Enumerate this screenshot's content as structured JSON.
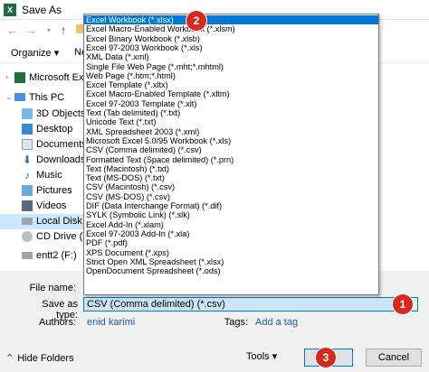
{
  "window": {
    "title": "Save As",
    "app_icon_letter": "X"
  },
  "commandbar": {
    "organize": "Organize ▾",
    "new_folder": "Ne"
  },
  "sidebar": {
    "items": [
      {
        "label": "Microsoft Excel",
        "icon": "excel-icon"
      },
      {
        "label": "This PC",
        "icon": "pc-icon"
      },
      {
        "label": "3D Objects",
        "icon": "3d-objects-icon"
      },
      {
        "label": "Desktop",
        "icon": "desktop-icon"
      },
      {
        "label": "Documents",
        "icon": "documents-icon"
      },
      {
        "label": "Downloads",
        "icon": "downloads-icon"
      },
      {
        "label": "Music",
        "icon": "music-icon"
      },
      {
        "label": "Pictures",
        "icon": "pictures-icon"
      },
      {
        "label": "Videos",
        "icon": "videos-icon"
      },
      {
        "label": "Local Disk (C:",
        "icon": "disk-icon"
      },
      {
        "label": "CD Drive (E:)",
        "icon": "cd-drive-icon"
      },
      {
        "label": "entt2 (F:)",
        "icon": "drive-icon"
      }
    ]
  },
  "dropdown": {
    "options": [
      "Excel Workbook (*.xlsx)",
      "Excel Macro-Enabled Workbook (*.xlsm)",
      "Excel Binary Workbook (*.xlsb)",
      "Excel 97-2003 Workbook (*.xls)",
      "XML Data (*.xml)",
      "Single File Web Page (*.mht;*.mhtml)",
      "Web Page (*.htm;*.html)",
      "Excel Template (*.xltx)",
      "Excel Macro-Enabled Template (*.xltm)",
      "Excel 97-2003 Template (*.xlt)",
      "Text (Tab delimited) (*.txt)",
      "Unicode Text (*.txt)",
      "XML Spreadsheet 2003 (*.xml)",
      "Microsoft Excel 5.0/95 Workbook (*.xls)",
      "CSV (Comma delimited) (*.csv)",
      "Formatted Text (Space delimited) (*.prn)",
      "Text (Macintosh) (*.txt)",
      "Text (MS-DOS) (*.txt)",
      "CSV (Macintosh) (*.csv)",
      "CSV (MS-DOS) (*.csv)",
      "DIF (Data Interchange Format) (*.dif)",
      "SYLK (Symbolic Link) (*.slk)",
      "Excel Add-In (*.xlam)",
      "Excel 97-2003 Add-In (*.xla)",
      "PDF (*.pdf)",
      "XPS Document (*.xps)",
      "Strict Open XML Spreadsheet (*.xlsx)",
      "OpenDocument Spreadsheet (*.ods)"
    ]
  },
  "form": {
    "file_name_label": "File name:",
    "save_as_type_label": "Save as type:",
    "save_as_type_value": "CSV (Comma delimited) (*.csv)",
    "authors_label": "Authors:",
    "authors_value": "enid karimi",
    "tags_label": "Tags:",
    "tags_value": "Add a tag"
  },
  "footer": {
    "hide_folders": "Hide Folders",
    "tools": "Tools",
    "save_button": "Sa",
    "cancel_button": "Cancel"
  },
  "markers": [
    "1",
    "2",
    "3"
  ],
  "colors": {
    "highlight": "#0078d7",
    "marker": "#d7291d",
    "link": "#1a5fb4"
  }
}
